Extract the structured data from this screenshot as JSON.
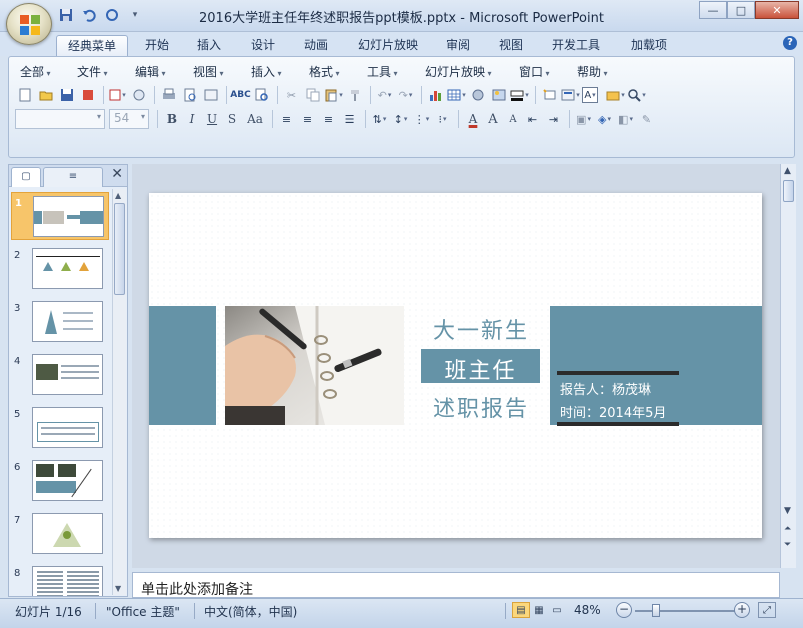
{
  "window": {
    "title": "2016大学班主任年终述职报告ppt模板.pptx - Microsoft PowerPoint",
    "minimize": "—",
    "maximize": "□",
    "close": "✕"
  },
  "qat": {
    "icons": [
      "save-icon",
      "undo-icon",
      "redo-icon",
      "customize-qat-icon"
    ]
  },
  "tabs": [
    "经典菜单",
    "开始",
    "插入",
    "设计",
    "动画",
    "幻灯片放映",
    "审阅",
    "视图",
    "开发工具",
    "加载项"
  ],
  "active_tab": "经典菜单",
  "menus": [
    "全部",
    "文件",
    "编辑",
    "视图",
    "插入",
    "格式",
    "工具",
    "幻灯片放映",
    "窗口",
    "帮助"
  ],
  "font": {
    "name_value": "",
    "size_value": "54"
  },
  "format_buttons": {
    "bold": "B",
    "italic": "I",
    "underline": "U",
    "strike": "S",
    "case": "Aa",
    "font_color": "A",
    "grow": "A",
    "shrink": "A"
  },
  "pane": {
    "tab_slides": "▢",
    "tab_outline": "≡",
    "close": "✕"
  },
  "thumbnails": [
    {
      "num": "1"
    },
    {
      "num": "2"
    },
    {
      "num": "3"
    },
    {
      "num": "4"
    },
    {
      "num": "5"
    },
    {
      "num": "6"
    },
    {
      "num": "7"
    },
    {
      "num": "8"
    }
  ],
  "selected_thumbnail": 1,
  "slide": {
    "line1": "大一新生",
    "line2": "班主任",
    "line3": "述职报告",
    "reporter": "报告人：杨茂琳",
    "time": "时间：2014年5月",
    "accent_color": "#6593a7"
  },
  "notes": {
    "placeholder": "单击此处添加备注"
  },
  "status": {
    "slide_count": "幻灯片 1/16",
    "theme": "\"Office 主题\"",
    "language": "中文(简体，中国)",
    "zoom": "48%",
    "zoom_out": "−",
    "zoom_in": "+",
    "fit_icon": "fit-window-icon"
  }
}
